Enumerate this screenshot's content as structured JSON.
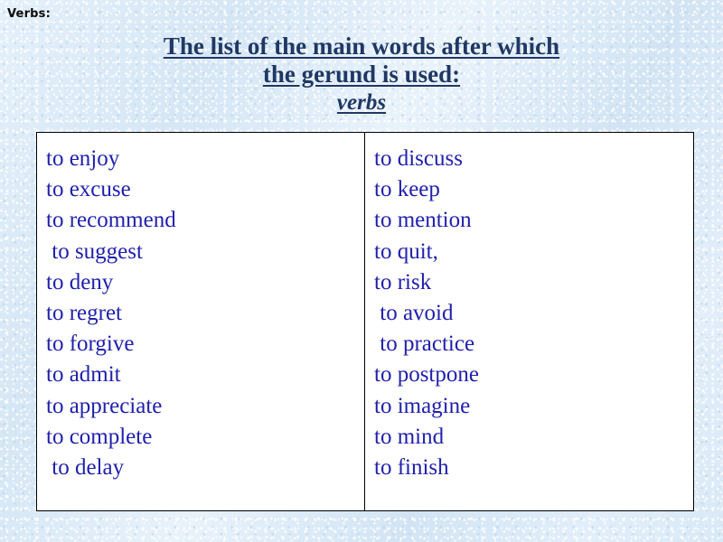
{
  "slide": {
    "corner_label": "Verbs:",
    "background_color": "#dbe9f6",
    "title": {
      "line1": "The list of the main words after which ",
      "line2": "the gerund is used:",
      "emphasis": "verbs",
      "color": "#1f3864"
    },
    "table": {
      "border_color": "#000000",
      "fill_color": "#ffffff",
      "text_color": "#2020ad",
      "left_column": [
        "to enjoy",
        "to excuse",
        "to recommend",
        " to suggest",
        "to deny",
        "to regret",
        "to forgive",
        "to admit",
        "to appreciate",
        "to complete",
        " to delay"
      ],
      "right_column": [
        "to discuss",
        "to keep",
        "to mention",
        "to quit,",
        "to risk",
        " to avoid",
        " to practice",
        "to postpone",
        "to imagine",
        "to mind",
        "to finish"
      ]
    }
  }
}
